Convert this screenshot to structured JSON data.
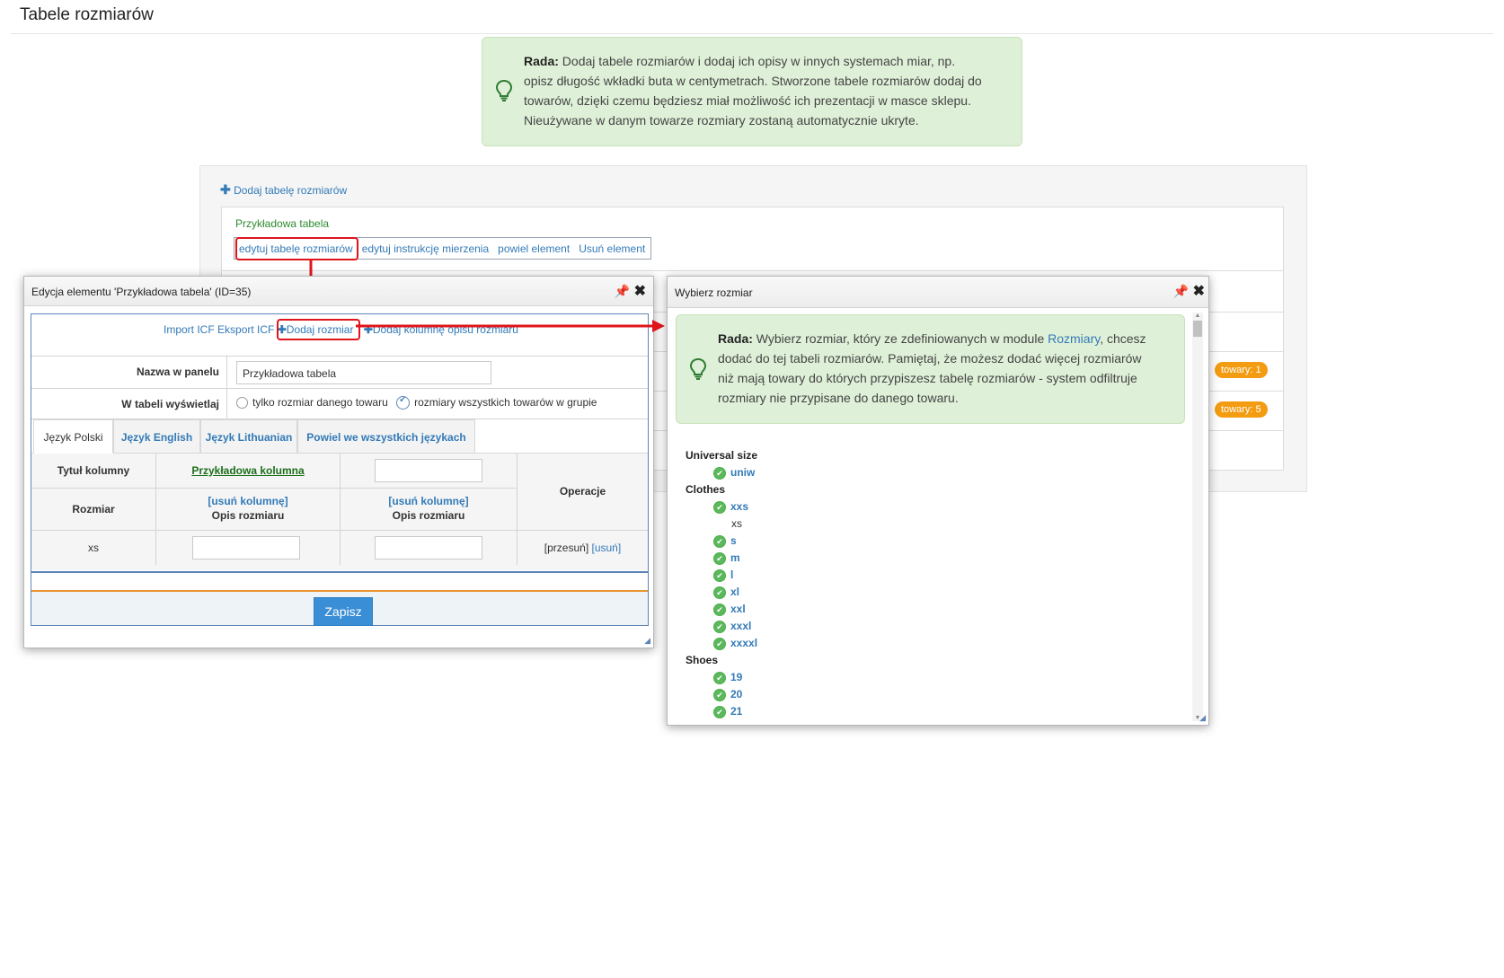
{
  "page": {
    "title": "Tabele rozmiarów"
  },
  "top_tip": {
    "label": "Rada:",
    "lines": [
      "Dodaj tabele rozmiarów i dodaj ich opisy w innych systemach miar, np.",
      "opisz długość wkładki buta w centymetrach. Stworzone tabele rozmiarów dodaj do",
      "towarów, dzięki czemu będziesz miał możliwość ich prezentacji w masce sklepu.",
      "Nieużywane w danym towarze rozmiary zostaną automatycznie ukryte."
    ],
    "icon": "lightbulb-icon"
  },
  "list": {
    "add_label": "Dodaj tabelę rozmiarów",
    "table_name": "Przykładowa tabela",
    "actions": [
      "edytuj tabelę rozmiarów",
      "edytuj instrukcję mierzenia",
      "powiel element",
      "Usuń element"
    ],
    "badges": [
      "towary: 1",
      "towary: 5"
    ]
  },
  "editor": {
    "title": "Edycja elementu 'Przykładowa tabela' (ID=35)",
    "toolbar": {
      "import": "Import ICF",
      "export": "Eksport ICF",
      "add_size": "Dodaj rozmiar",
      "add_column": "Dodaj kolumnę opisu rozmiaru"
    },
    "name_label": "Nazwa w panelu",
    "name_value": "Przykładowa tabela",
    "display_label": "W tabeli wyświetlaj",
    "display_options": [
      "tylko rozmiar danego towaru",
      "rozmiary wszystkich towarów w grupie"
    ],
    "tabs": [
      "Język Polski",
      "Język English",
      "Język Lithuanian",
      "Powiel we wszystkich językach"
    ],
    "table": {
      "column_title_label": "Tytuł kolumny",
      "column_title_value": "Przykładowa kolumna",
      "size_header": "Rozmiar",
      "remove_column": "[usuń kolumnę]",
      "size_desc": "Opis rozmiaru",
      "operations": "Operacje",
      "row_size": "xs",
      "move": "[przesuń]",
      "remove": "[usuń]"
    },
    "save": "Zapisz"
  },
  "picker": {
    "title": "Wybierz rozmiar",
    "tip": {
      "label": "Rada:",
      "line1_a": "Wybierz rozmiar, który ze zdefiniowanych w module",
      "line1_link": "Rozmiary",
      "line1_b": ", chcesz",
      "lines": [
        "dodać do tej tabeli rozmiarów. Pamiętaj, że możesz dodać więcej rozmiarów",
        "niż mają towary do których przypiszesz tabelę rozmiarów - system odfiltruje",
        "rozmiary nie przypisane do danego towaru."
      ]
    },
    "categories": [
      {
        "name": "Universal size",
        "items": [
          {
            "label": "uniw",
            "available": true
          }
        ]
      },
      {
        "name": "Clothes",
        "items": [
          {
            "label": "xxs",
            "available": true
          },
          {
            "label": "xs",
            "available": false
          },
          {
            "label": "s",
            "available": true
          },
          {
            "label": "m",
            "available": true
          },
          {
            "label": "l",
            "available": true
          },
          {
            "label": "xl",
            "available": true
          },
          {
            "label": "xxl",
            "available": true
          },
          {
            "label": "xxxl",
            "available": true
          },
          {
            "label": "xxxxl",
            "available": true
          }
        ]
      },
      {
        "name": "Shoes",
        "items": [
          {
            "label": "19",
            "available": true
          },
          {
            "label": "20",
            "available": true
          },
          {
            "label": "21",
            "available": true
          }
        ]
      }
    ]
  },
  "colors": {
    "accent": "#337ab7",
    "highlight": "#e0151b",
    "badge": "#f39c12",
    "tip_bg": "#dff0d8",
    "check": "#5cb85c"
  }
}
